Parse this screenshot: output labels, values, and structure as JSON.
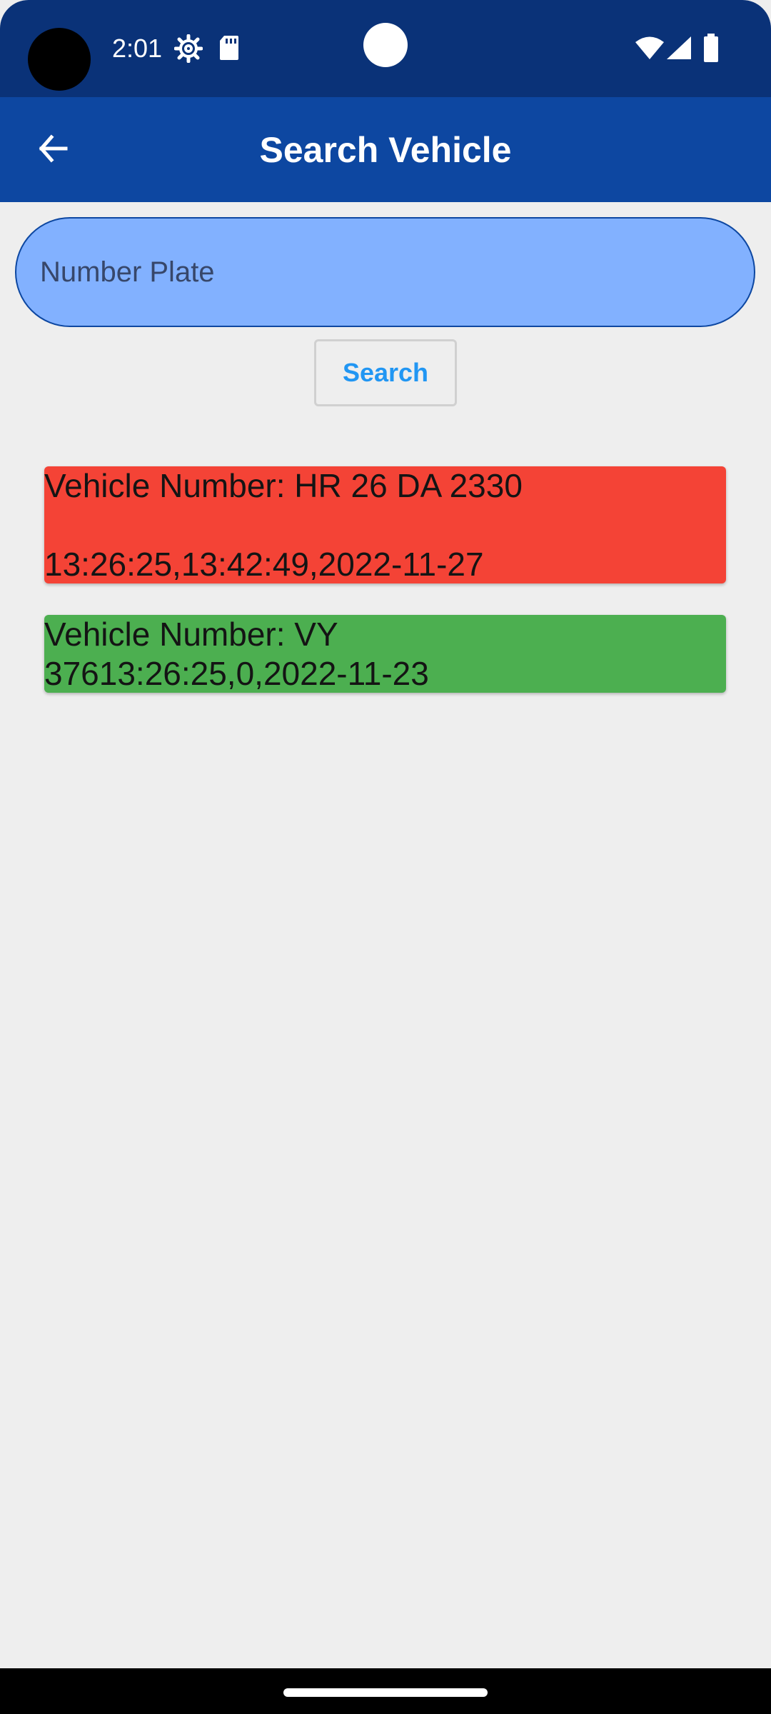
{
  "status_bar": {
    "time": "2:01",
    "icons": [
      "settings-icon",
      "sd-card-icon",
      "wifi-icon",
      "signal-icon",
      "battery-icon"
    ]
  },
  "app_bar": {
    "title": "Search Vehicle",
    "back_icon": "arrow-back-icon"
  },
  "search": {
    "placeholder": "Number Plate",
    "value": "",
    "button_label": "Search"
  },
  "records": [
    {
      "status_color": "#f44336",
      "line1": "Vehicle Number: HR 26 DA 2330",
      "line2": "",
      "line3": "13:26:25,13:42:49,2022-11-27"
    },
    {
      "status_color": "#4caf50",
      "line1": "Vehicle Number: VY",
      "line2": "37613:26:25,0,2022-11-23"
    }
  ],
  "colors": {
    "status_bar": "#0a3278",
    "app_bar": "#0d47a1",
    "input_fill": "#82b1ff",
    "button_text": "#2196f3",
    "background": "#eeeeee"
  }
}
